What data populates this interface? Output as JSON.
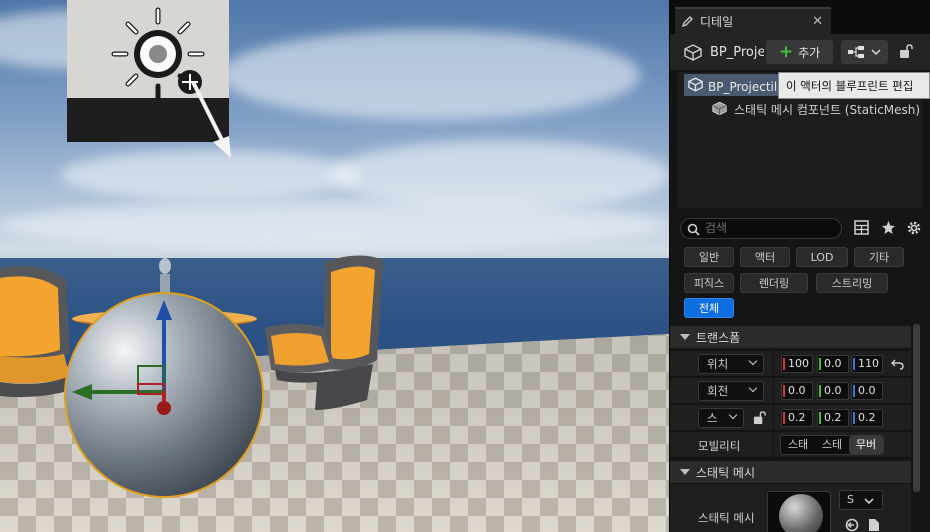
{
  "details_panel": {
    "tab_label": "디테일",
    "actor_name": "BP_Projectile",
    "add_button_label": "추가",
    "tooltip": "이 액터의 블루프린트 편집",
    "component_tree": [
      {
        "label": "BP_Projectile (셀프)"
      },
      {
        "label": "스태틱 메시 컴포넌트 (StaticMesh)"
      }
    ],
    "search_placeholder": "검색",
    "filters": [
      "일반",
      "액터",
      "LOD",
      "기타",
      "피직스",
      "렌더링",
      "스트리밍",
      "전체"
    ],
    "active_filter": "전체",
    "sections": {
      "transform": {
        "title": "트랜스폼",
        "location": {
          "label": "위치",
          "x": "100",
          "y": "0.0",
          "z": "110"
        },
        "rotation": {
          "label": "회전",
          "x": "0.0",
          "y": "0.0",
          "z": "0.0"
        },
        "scale": {
          "label": "스",
          "x": "0.2",
          "y": "0.2",
          "z": "0.2"
        },
        "mobility": {
          "label": "모빌리티",
          "options": [
            "스태",
            "스테",
            "무버"
          ],
          "selected": "무버"
        }
      },
      "static_mesh": {
        "title": "스태틱 메시",
        "mesh_label": "스태틱 메시",
        "mesh_value": "S"
      }
    }
  },
  "colors": {
    "accent_blue": "#0f6fe0",
    "selection": "#4a5a70",
    "gizmo_x": "#d23b3b",
    "gizmo_y": "#3fbf3f",
    "gizmo_z": "#1f4fa8",
    "outline": "#e0a020"
  }
}
